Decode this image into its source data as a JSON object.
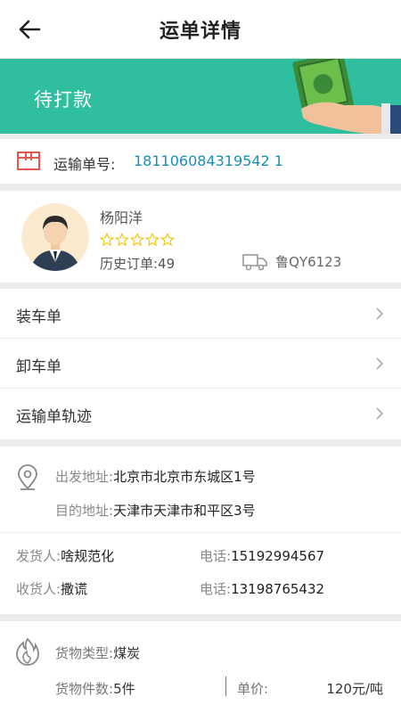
{
  "header": {
    "title": "运单详情"
  },
  "banner": {
    "status": "待打款"
  },
  "order": {
    "label": "运输单号:",
    "number": "181106084319542 1"
  },
  "driver": {
    "name": "杨阳洋",
    "rating": 0,
    "max_rating": 5,
    "history": "历史订单:49",
    "plate": "鲁QY6123"
  },
  "menu": {
    "items": [
      {
        "label": "装车单"
      },
      {
        "label": "卸车单"
      },
      {
        "label": "运输单轨迹"
      }
    ]
  },
  "address": {
    "from_label": "出发地址:",
    "from_value": "北京市北京市东城区1号",
    "to_label": "目的地址:",
    "to_value": "天津市天津市和平区3号",
    "sender_label": "发货人:",
    "sender_value": "啥规范化",
    "sender_phone_label": "电话:",
    "sender_phone": "15192994567",
    "receiver_label": "收货人:",
    "receiver_value": "撒谎",
    "receiver_phone_label": "电话:",
    "receiver_phone": "13198765432"
  },
  "goods": {
    "type_label": "货物类型:",
    "type_value": "煤炭",
    "count_label": "货物件数:",
    "count_value": "5件",
    "price_label": "单价:",
    "price_value": "120元/吨"
  },
  "colors": {
    "accent": "#2fbf9f",
    "link": "#1a8fb4",
    "star": "#f2c200"
  }
}
